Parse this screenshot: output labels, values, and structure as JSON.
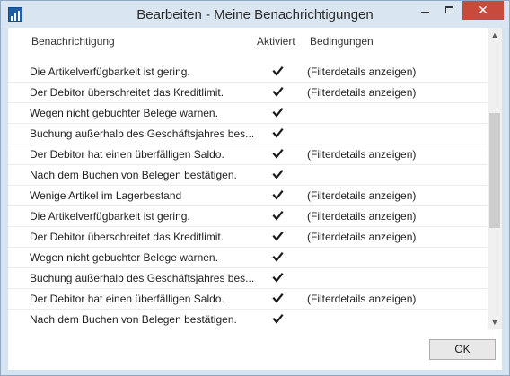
{
  "window": {
    "title": "Bearbeiten - Meine Benachrichtigungen",
    "close_glyph": "✕"
  },
  "columns": {
    "notification": "Benachrichtigung",
    "active": "Aktiviert",
    "conditions": "Bedingungen"
  },
  "rows": [
    {
      "name": "Die Artikelverfügbarkeit ist gering.",
      "active": true,
      "conditions": "(Filterdetails anzeigen)"
    },
    {
      "name": "Der Debitor überschreitet das Kreditlimit.",
      "active": true,
      "conditions": "(Filterdetails anzeigen)"
    },
    {
      "name": "Wegen nicht gebuchter Belege warnen.",
      "active": true,
      "conditions": ""
    },
    {
      "name": "Buchung außerhalb des Geschäftsjahres bes...",
      "active": true,
      "conditions": ""
    },
    {
      "name": "Der Debitor hat einen überfälligen Saldo.",
      "active": true,
      "conditions": "(Filterdetails anzeigen)"
    },
    {
      "name": "Nach dem Buchen von Belegen bestätigen.",
      "active": true,
      "conditions": ""
    },
    {
      "name": "Wenige Artikel im Lagerbestand",
      "active": true,
      "conditions": "(Filterdetails anzeigen)"
    },
    {
      "name": "Die Artikelverfügbarkeit ist gering.",
      "active": true,
      "conditions": "(Filterdetails anzeigen)"
    },
    {
      "name": "Der Debitor überschreitet das Kreditlimit.",
      "active": true,
      "conditions": "(Filterdetails anzeigen)"
    },
    {
      "name": "Wegen nicht gebuchter Belege warnen.",
      "active": true,
      "conditions": ""
    },
    {
      "name": "Buchung außerhalb des Geschäftsjahres bes...",
      "active": true,
      "conditions": ""
    },
    {
      "name": "Der Debitor hat einen überfälligen Saldo.",
      "active": true,
      "conditions": "(Filterdetails anzeigen)"
    },
    {
      "name": "Nach dem Buchen von Belegen bestätigen.",
      "active": true,
      "conditions": ""
    }
  ],
  "buttons": {
    "ok": "OK"
  },
  "icons": {
    "app": "app-icon",
    "check": "checkmark-icon",
    "scroll_up": "scroll-up-arrow-icon",
    "scroll_down": "scroll-down-arrow-icon"
  },
  "colors": {
    "title_bar": "#d9e6f2",
    "close_button": "#c74a3c",
    "app_icon": "#1f5ea8"
  }
}
